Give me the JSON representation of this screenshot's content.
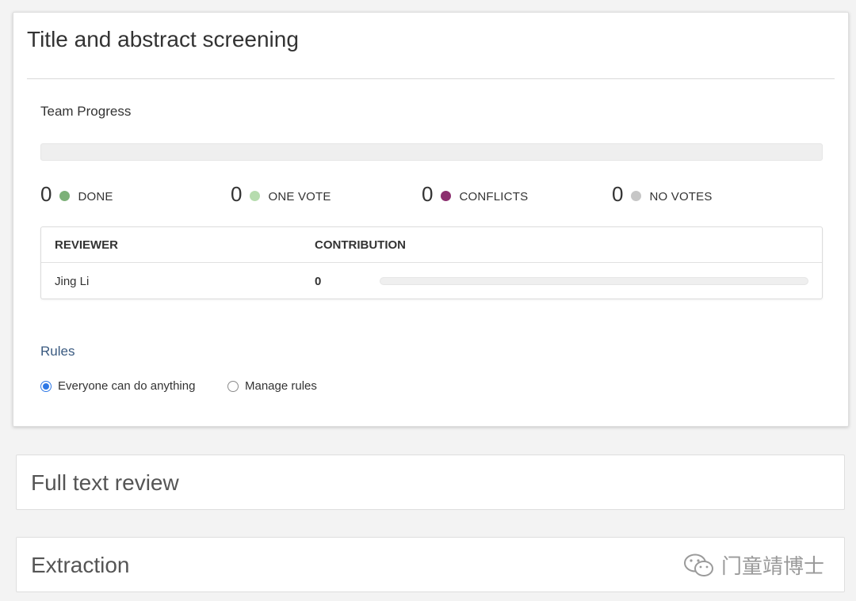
{
  "screening": {
    "title": "Title and abstract screening",
    "team_progress_label": "Team Progress",
    "team_progress_fraction": 0,
    "stats": [
      {
        "count": "0",
        "label": "DONE",
        "color": "#7cb178"
      },
      {
        "count": "0",
        "label": "ONE VOTE",
        "color": "#b6dcae"
      },
      {
        "count": "0",
        "label": "CONFLICTS",
        "color": "#8c2f6f"
      },
      {
        "count": "0",
        "label": "NO VOTES",
        "color": "#c6c6c6"
      }
    ],
    "table": {
      "headers": {
        "reviewer": "REVIEWER",
        "contribution": "CONTRIBUTION"
      },
      "rows": [
        {
          "reviewer": "Jing Li",
          "contribution": "0",
          "contribution_fraction": 0
        }
      ]
    },
    "rules": {
      "heading": "Rules",
      "options": [
        {
          "label": "Everyone can do anything",
          "selected": true
        },
        {
          "label": "Manage rules",
          "selected": false
        }
      ]
    }
  },
  "full_text_review": {
    "title": "Full text review"
  },
  "extraction": {
    "title": "Extraction"
  },
  "watermark": {
    "text": "门童靖博士",
    "icon": "wechat-icon"
  }
}
